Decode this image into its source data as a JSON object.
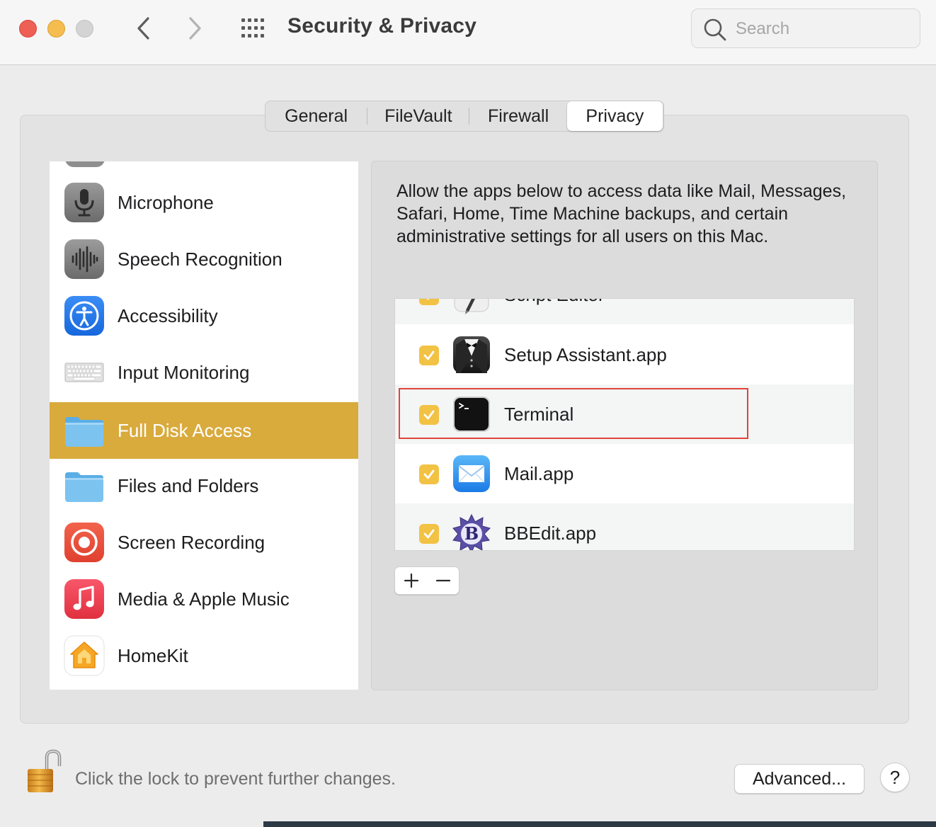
{
  "window": {
    "title": "Security & Privacy",
    "search_placeholder": "Search"
  },
  "tabs": [
    {
      "label": "General",
      "selected": false
    },
    {
      "label": "FileVault",
      "selected": false
    },
    {
      "label": "Firewall",
      "selected": false
    },
    {
      "label": "Privacy",
      "selected": true
    }
  ],
  "sidebar": {
    "items": [
      {
        "label": "Microphone",
        "icon": "microphone-icon"
      },
      {
        "label": "Speech Recognition",
        "icon": "waveform-icon"
      },
      {
        "label": "Accessibility",
        "icon": "accessibility-icon"
      },
      {
        "label": "Input Monitoring",
        "icon": "keyboard-icon"
      },
      {
        "label": "Full Disk Access",
        "icon": "folder-icon",
        "selected": true
      },
      {
        "label": "Files and Folders",
        "icon": "folder-icon"
      },
      {
        "label": "Screen Recording",
        "icon": "screen-recording-icon"
      },
      {
        "label": "Media & Apple Music",
        "icon": "music-note-icon"
      },
      {
        "label": "HomeKit",
        "icon": "home-icon"
      }
    ],
    "selected_color": "#d9ab3d"
  },
  "description": "Allow the apps below to access data like Mail, Messages, Safari, Home, Time Machine backups, and certain administrative settings for all users on this Mac.",
  "apps": [
    {
      "label": "Script Editor",
      "checked": true,
      "icon": "script-editor-icon"
    },
    {
      "label": "Setup Assistant.app",
      "checked": true,
      "icon": "tuxedo-icon"
    },
    {
      "label": "Terminal",
      "checked": true,
      "icon": "terminal-icon",
      "highlighted": true
    },
    {
      "label": "Mail.app",
      "checked": true,
      "icon": "mail-icon"
    },
    {
      "label": "BBEdit.app",
      "checked": true,
      "icon": "bbedit-icon"
    }
  ],
  "list_buttons": {
    "add": "+",
    "remove": "—"
  },
  "footer": {
    "lock_text": "Click the lock to prevent further changes.",
    "advanced_label": "Advanced...",
    "help_label": "?"
  },
  "colors": {
    "checkbox": "#f2c244",
    "highlight_border": "#e0443a",
    "close": "#ee5f56",
    "minimize": "#f5bd4f"
  }
}
